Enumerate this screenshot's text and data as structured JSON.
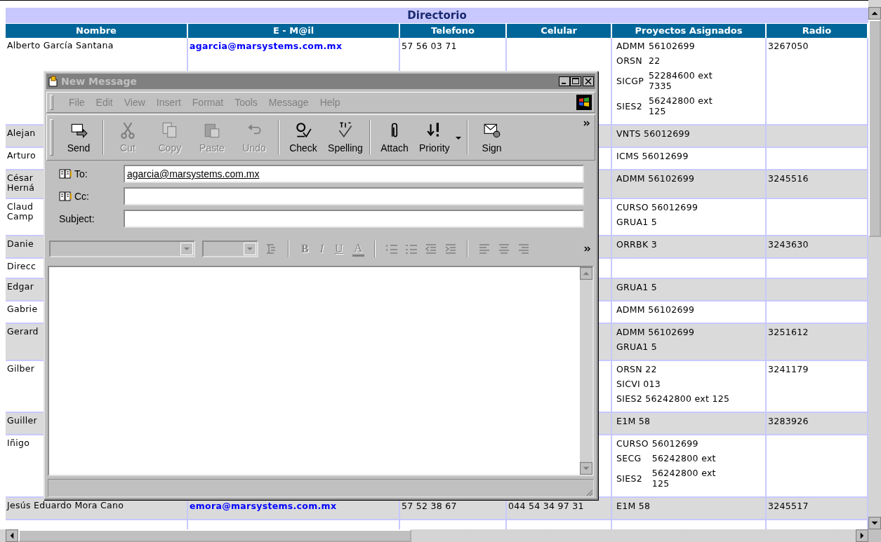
{
  "page_title": "Directorio",
  "columns": [
    "Nombre",
    "E - M@il",
    "Telefono",
    "Celular",
    "Proyectos Asignados",
    "Radio"
  ],
  "rows": [
    {
      "kind": "aligned",
      "name": [
        "Alberto García Santana"
      ],
      "email": "agarcia@marsystems.com.mx",
      "phone": "57 56 03 71",
      "projects": [
        {
          "code": "ADMM",
          "value": "56102699"
        },
        {
          "code": "ORSN",
          "value": "22"
        },
        {
          "code": "SICGP",
          "value": "52284600 ext 7335"
        },
        {
          "code": "SIES2",
          "value": "56242800 ext 125"
        }
      ],
      "radio": "3267050"
    },
    {
      "kind": "plain",
      "name": [
        "Alejan"
      ],
      "projects": [
        {
          "code": "VNTS",
          "value": "56012699"
        }
      ]
    },
    {
      "kind": "plain",
      "name": [
        "Arturo"
      ],
      "projects": [
        {
          "code": "ICMS",
          "value": "56012699"
        }
      ]
    },
    {
      "kind": "plain",
      "name": [
        "César",
        "Herná"
      ],
      "projects": [
        {
          "code": "ADMM",
          "value": "56102699"
        }
      ],
      "radio": "3245516"
    },
    {
      "kind": "plain",
      "name": [
        "Claud",
        "Camp"
      ],
      "projects": [
        {
          "code": "CURSO",
          "value": "56012699"
        },
        {
          "code": "GRUA1",
          "value": "5"
        }
      ]
    },
    {
      "kind": "plain",
      "name": [
        "Danie"
      ],
      "projects": [
        {
          "code": "ORRBK",
          "value": "3"
        }
      ],
      "radio": "3243630"
    },
    {
      "kind": "plain",
      "name": [
        "Direcc"
      ]
    },
    {
      "kind": "plain",
      "name": [
        "Edgar"
      ],
      "projects": [
        {
          "code": "GRUA1",
          "value": "5"
        }
      ]
    },
    {
      "kind": "plain",
      "name": [
        "Gabrie"
      ],
      "projects": [
        {
          "code": "ADMM",
          "value": "56102699"
        }
      ]
    },
    {
      "kind": "plain",
      "name": [
        "Gerard"
      ],
      "projects": [
        {
          "code": "ADMM",
          "value": "56102699"
        },
        {
          "code": "GRUA1",
          "value": "5"
        }
      ],
      "radio": "3251612"
    },
    {
      "kind": "plain",
      "name": [
        "Gilber"
      ],
      "projects": [
        {
          "code": "ORSN",
          "value": "22"
        },
        {
          "code": "SICVI",
          "value": "013"
        },
        {
          "code": "SIES2",
          "value": "56242800 ext 125"
        }
      ],
      "radio": "3241179"
    },
    {
      "kind": "plain",
      "name": [
        "Guiller"
      ],
      "projects": [
        {
          "code": "E1M",
          "value": "58"
        }
      ],
      "radio": "3283926"
    },
    {
      "kind": "aligned",
      "name": [
        "Iñigo"
      ],
      "projects": [
        {
          "code": "CURSO",
          "value": "56012699"
        },
        {
          "code": "SECG",
          "value": "56242800 ext"
        },
        {
          "code": "SIES2",
          "value": "56242800 ext 125"
        }
      ]
    },
    {
      "kind": "plain",
      "name": [
        "Jesús Eduardo Mora Cano"
      ],
      "email": "emora@marsystems.com.mx",
      "phone": "57 52 38 67",
      "mobile": "044 54 34 97 31",
      "projects": [
        {
          "code": "E1M",
          "value": "58"
        }
      ],
      "radio": "3245517"
    }
  ],
  "message_window": {
    "title": "New Message",
    "active": false,
    "menu": [
      "File",
      "Edit",
      "View",
      "Insert",
      "Format",
      "Tools",
      "Message",
      "Help"
    ],
    "toolbar": [
      [
        {
          "label": "Send",
          "kind": "send",
          "disabled": false,
          "dropdown": false
        }
      ],
      [
        {
          "label": "Cut",
          "kind": "cut",
          "disabled": true,
          "dropdown": false
        },
        {
          "label": "Copy",
          "kind": "copy",
          "disabled": true,
          "dropdown": false
        },
        {
          "label": "Paste",
          "kind": "paste",
          "disabled": true,
          "dropdown": false
        },
        {
          "label": "Undo",
          "kind": "undo",
          "disabled": true,
          "dropdown": false
        }
      ],
      [
        {
          "label": "Check",
          "kind": "check",
          "disabled": false,
          "dropdown": false
        },
        {
          "label": "Spelling",
          "kind": "spelling",
          "disabled": false,
          "dropdown": false
        }
      ],
      [
        {
          "label": "Attach",
          "kind": "attach",
          "disabled": false,
          "dropdown": false
        },
        {
          "label": "Priority",
          "kind": "priority",
          "disabled": false,
          "dropdown": true
        }
      ],
      [
        {
          "label": "Sign",
          "kind": "sign",
          "disabled": false,
          "dropdown": false
        }
      ]
    ],
    "fields": [
      {
        "label": "To:",
        "value": "agarcia@marsystems.com.mx",
        "address_book": true
      },
      {
        "label": "Cc:",
        "address_book": true
      },
      {
        "label": "Subject:",
        "address_book": false
      }
    ],
    "format_buttons": [
      {
        "label": "B",
        "kind": "bold",
        "disabled": true
      },
      {
        "label": "I",
        "kind": "italic",
        "disabled": true
      },
      {
        "label": "U",
        "kind": "underline",
        "disabled": true
      },
      {
        "label": "A",
        "kind": "color",
        "disabled": true
      }
    ]
  }
}
